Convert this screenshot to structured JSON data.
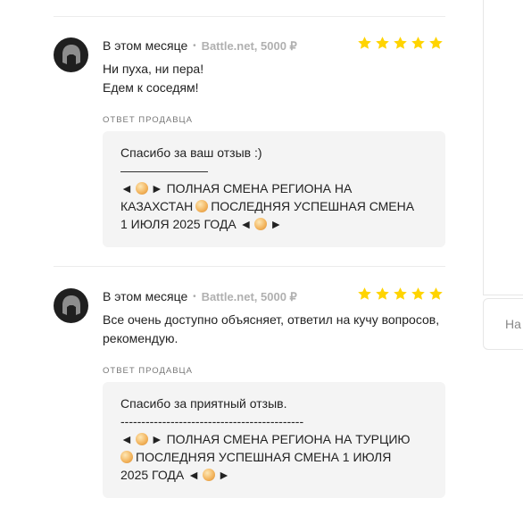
{
  "reviews": [
    {
      "date": "В этом месяце",
      "game": "Battle.net, 5000 ₽",
      "rating": 5,
      "text_lines": [
        "Ни пуха, ни пера!",
        "Едем к соседям!"
      ],
      "seller_label": "Ответ продавца",
      "reply": {
        "line1": "Спасибо за ваш отзыв :)",
        "line2": "———————",
        "line3a": "◄",
        "line3b": "► ПОЛНАЯ СМЕНА РЕГИОНА НА",
        "line4a": "КАЗАХСТАН",
        "line4b": "ПОСЛЕДНЯЯ УСПЕШНАЯ СМЕНА",
        "line5a": "1 ИЮЛЯ 2025 ГОДА ◄",
        "line5b": "►"
      }
    },
    {
      "date": "В этом месяце",
      "game": "Battle.net, 5000 ₽",
      "rating": 5,
      "text_lines": [
        "Все очень доступно объясняет, ответил на кучу вопросов,",
        "рекомендую."
      ],
      "seller_label": "Ответ продавца",
      "reply": {
        "line1": "Спасибо за приятный отзыв.",
        "line2": "--------------------------------------------",
        "line3a": "◄",
        "line3b": "► ПОЛНАЯ СМЕНА РЕГИОНА НА ТУРЦИЮ",
        "line4a": "",
        "line4b": "ПОСЛЕДНЯЯ УСПЕШНАЯ СМЕНА 1 ИЮЛЯ",
        "line5a": "2025 ГОДА ◄",
        "line5b": "►"
      }
    }
  ],
  "side": {
    "box_label": "На"
  },
  "colors": {
    "star": "#ffd400",
    "reply_bg": "#f4f4f4",
    "avatar_bg": "#1f1f1f"
  }
}
